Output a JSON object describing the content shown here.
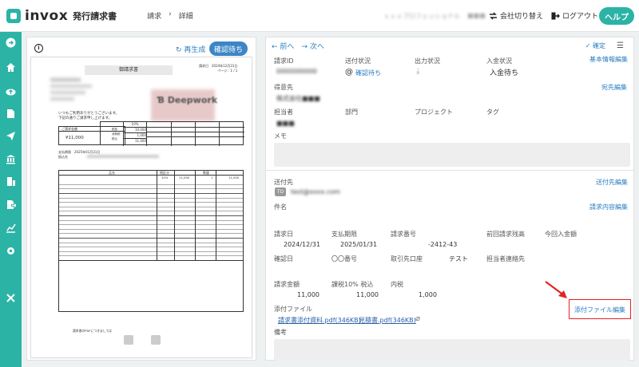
{
  "app": {
    "logo_text": "invox",
    "subtitle": "発行請求書"
  },
  "breadcrumb": {
    "first": "請求",
    "sep": "›",
    "second": "詳細"
  },
  "header": {
    "company_name": "ｘｘｘプロフェッショナル",
    "user_name": "■■■",
    "switch_label": "会社切り替え",
    "logout_label": "ログアウト",
    "help_label": "ヘルプ"
  },
  "sidebar": {
    "icons": [
      "arrow-circle-icon",
      "home-icon",
      "cloud-upload-icon",
      "document-icon",
      "send-icon",
      "bank-icon",
      "building-icon",
      "export-icon",
      "chart-icon",
      "gear-icon",
      "tools-icon"
    ]
  },
  "preview": {
    "regen_label": "再生成",
    "status_pill": "確認待ち",
    "doc": {
      "title": "御請求書",
      "date_label": "請求日",
      "date_value": "2024年12月31日",
      "page_label": "ページ：1 / 1",
      "greeting1": "いつもご利用ありがとうございます。",
      "greeting2": "下記の通りご請求申し上げます。",
      "amount_label": "ご請求金額",
      "amount_value": "¥11,000",
      "tax_rate": "10%",
      "subtotal_label": "税抜",
      "subtotal": "10,000",
      "tax_label": "消費税",
      "tax": "1,000",
      "total_label": "税込",
      "total": "11,000",
      "due_label": "支払期限",
      "due_value": "2025年01月31日",
      "bank_label": "振込先",
      "col_item": "品名",
      "col_rate": "税区分",
      "col_qty": "数量",
      "row_rate": "10%",
      "row_price": "11,000",
      "row_qty": "1",
      "row_amount": "11,000",
      "footer": "請求書のPDFにつきましては"
    }
  },
  "detail": {
    "prev": "前へ",
    "next": "次へ",
    "confirm": "確定",
    "invoice_id_label": "請求ID",
    "invoice_id_value": "0000000000",
    "send_status_label": "送付状況",
    "send_status_value": "確認待ち",
    "output_status_label": "出力状況",
    "payment_status_label": "入金状況",
    "payment_status_value": "入金待ち",
    "basic_edit": "基本情報編集",
    "customer_label": "得意先",
    "customer_value": "株式会社■■■",
    "address_edit": "宛先編集",
    "owner_label": "担当者",
    "owner_value": "■■■",
    "dept_label": "部門",
    "project_label": "プロジェクト",
    "tag_label": "タグ",
    "memo_label": "メモ",
    "send_to_label": "送付先",
    "to_tag": "TO",
    "send_to_value": "test@xxxx.com",
    "send_edit": "送付先編集",
    "subject_label": "件名",
    "content_edit": "請求内容編集",
    "invoice_date_label": "請求日",
    "invoice_date_value": "2024/12/31",
    "due_label": "支払期限",
    "due_value": "2025/01/31",
    "number_label": "請求番号",
    "number_value": "-2412-43",
    "prev_balance_label": "前回請求残高",
    "current_payment_label": "今回入金額",
    "confirm_date_label": "確認日",
    "oo_label": "〇〇番号",
    "bank_label": "取引先口座",
    "test_value": "テスト",
    "contact_label": "担当者連絡先",
    "amount_label": "請求金額",
    "amount_value": "11,000",
    "taxable_label": "課税10% 税込",
    "taxable_value": "11,000",
    "inner_tax_label": "内税",
    "inner_tax_value": "1,000",
    "attach_label": "添付ファイル",
    "attach_edit": "添付ファイル編集",
    "file1": "請求書添付資料.pdf(346KB)",
    "file2": "見積書.pdf(346KB)",
    "remark_label": "備考"
  },
  "colors": {
    "accent": "#2bb3a6",
    "link": "#2a7ec1",
    "status_pill": "#3d86c6",
    "highlight": "#e52222"
  }
}
